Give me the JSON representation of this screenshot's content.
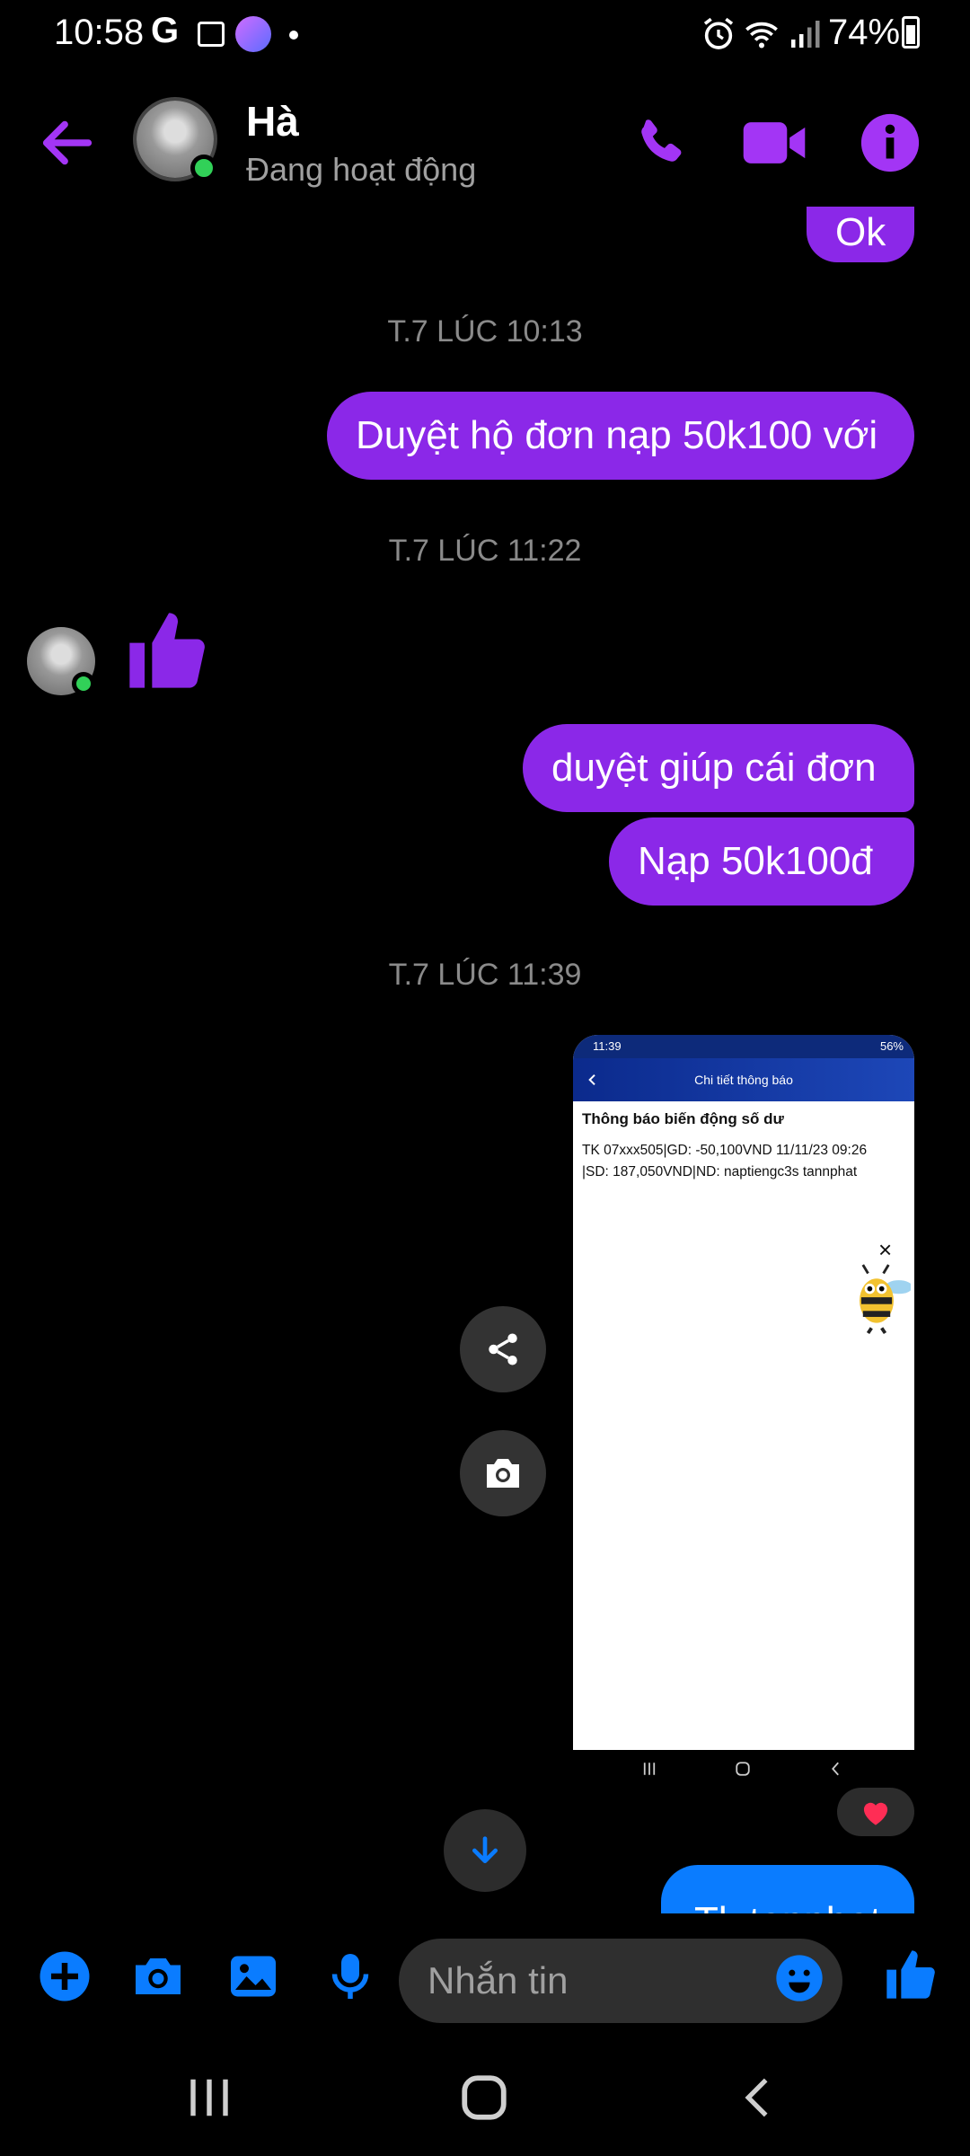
{
  "status_bar": {
    "time": "10:58",
    "g_label": "G",
    "battery": "74%"
  },
  "header": {
    "name": "Hà",
    "status": "Đang hoạt động"
  },
  "messages": {
    "ok": "Ok",
    "time1": "T.7 LÚC 10:13",
    "msg1": "Duyệt hộ đơn nạp 50k100 với",
    "time2": "T.7 LÚC 11:22",
    "time3": "T.7 LÚC 11:39",
    "msg2": "duyệt giúp cái đơn",
    "msg3": "Nạp 50k100đ",
    "last": "Tk tanphat"
  },
  "screenshot": {
    "status_time": "11:39",
    "status_battery": "56%",
    "header_title": "Chi tiết thông báo",
    "title": "Thông báo biến động số dư",
    "line1": "TK 07xxx505|GD: -50,100VND 11/11/23 09:26",
    "line2": "|SD: 187,050VND|ND: naptiengc3s tannphat",
    "close": "×"
  },
  "composer": {
    "placeholder": "Nhắn tin"
  },
  "colors": {
    "accent": "#8b28e8",
    "blue": "#0a7cff",
    "online": "#31d158"
  },
  "icons": [
    "back-arrow-icon",
    "phone-icon",
    "video-camera-icon",
    "info-icon",
    "thumbs-up-icon",
    "share-icon",
    "camera-icon",
    "heart-icon",
    "arrow-down-icon",
    "plus-icon",
    "gallery-icon",
    "microphone-icon",
    "emoji-icon",
    "recents-icon",
    "home-icon",
    "back-icon"
  ]
}
